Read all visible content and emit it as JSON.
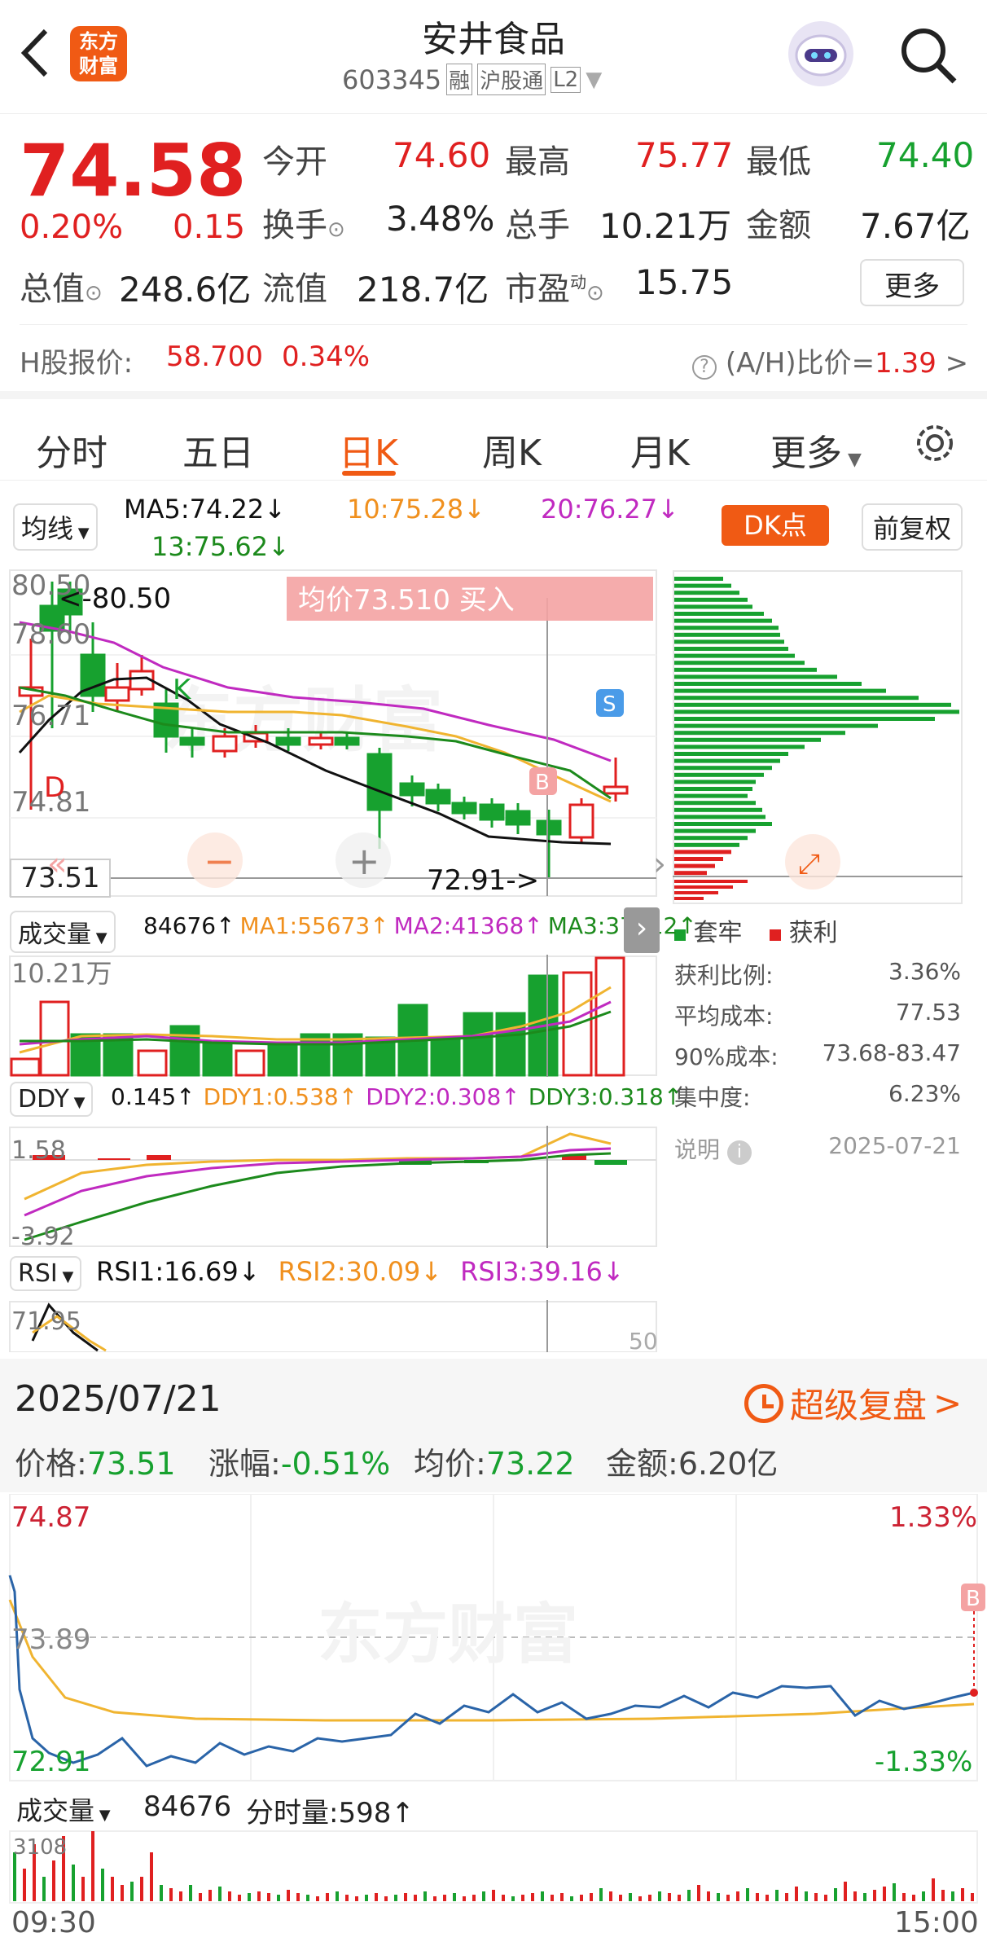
{
  "header": {
    "title": "安井食品",
    "code": "603345",
    "badges": [
      "融",
      "沪股通",
      "L2"
    ],
    "logo_text": "东方\n财富"
  },
  "quote": {
    "price": "74.58",
    "change_pct": "0.20%",
    "change": "0.15",
    "open_label": "今开",
    "open": "74.60",
    "high_label": "最高",
    "high": "75.77",
    "low_label": "最低",
    "low": "74.40",
    "turnover_label": "换手",
    "turnover": "3.48%",
    "volume_label": "总手",
    "volume": "10.21万",
    "amount_label": "金额",
    "amount": "7.67亿",
    "mktcap_label": "总值",
    "mktcap": "248.6亿",
    "float_label": "流值",
    "float": "218.7亿",
    "pe_label": "市盈",
    "pe_sup": "动",
    "pe": "15.75",
    "more_button": "更多",
    "h_label": "H股报价:",
    "h_price": "58.700",
    "h_pct": "0.34%",
    "ah_label": "(A/H)比价=",
    "ah_value": "1.39"
  },
  "tabs": [
    "分时",
    "五日",
    "日K",
    "周K",
    "月K",
    "更多"
  ],
  "active_tab": "日K",
  "kline": {
    "ma_select": "均线",
    "ma5": "MA5:74.22↓",
    "ma10": "10:75.28↓",
    "ma20": "20:76.27↓",
    "ma13": "13:75.62↓",
    "dk_button": "DK点",
    "adjust_button": "前复权",
    "axis_top": "80.50",
    "axis_2": "78.60",
    "axis_3": "76.71",
    "axis_4": "74.81",
    "axis_cursor": "73.51",
    "high_label": "<-80.50",
    "low_label": "72.91->",
    "banner": "均价73.510  买入",
    "marker_d": "D",
    "marker_k": "K",
    "marker_b": "B",
    "marker_s": "S"
  },
  "volume_panel": {
    "select": "成交量",
    "vol": "84676↑",
    "ma1": "MA1:55673↑",
    "ma2": "MA2:41368↑",
    "ma3": "MA3:37112↑",
    "axis_top": "10.21万"
  },
  "ddy_panel": {
    "select": "DDY",
    "v": "0.145↑",
    "ddy1": "DDY1:0.538↑",
    "ddy2": "DDY2:0.308↑",
    "ddy3": "DDY3:0.318↑",
    "axis_top": "1.58",
    "axis_bottom": "-3.92"
  },
  "rsi_panel": {
    "select": "RSI",
    "rsi1": "RSI1:16.69↓",
    "rsi2": "RSI2:30.09↓",
    "rsi3": "RSI3:39.16↓",
    "axis_top": "71.95",
    "axis_right": "50"
  },
  "chips": {
    "legend_trapped": "套牢",
    "legend_profit": "获利",
    "rows": [
      {
        "label": "获利比例:",
        "value": "3.36%"
      },
      {
        "label": "平均成本:",
        "value": "77.53"
      },
      {
        "label": "90%成本:",
        "value": "73.68-83.47"
      },
      {
        "label": "集中度:",
        "value": "6.23%"
      }
    ],
    "note_label": "说明",
    "date": "2025-07-21"
  },
  "intraday": {
    "date": "2025/07/21",
    "replay": "超级复盘",
    "price_label": "价格:",
    "price": "73.51",
    "chg_label": "涨幅:",
    "chg": "-0.51%",
    "avg_label": "均价:",
    "avg": "73.22",
    "amt_label": "金额:",
    "amt": "6.20亿",
    "axis_top": "74.87",
    "axis_mid": "73.89",
    "axis_bottom": "72.91",
    "pct_top": "1.33%",
    "pct_bottom": "-1.33%",
    "vol_select": "成交量",
    "vol": "84676",
    "tick_label": "分时量:598↑",
    "vol_axis": "3108",
    "time_start": "09:30",
    "time_end": "15:00",
    "marker_b": "B"
  },
  "colors": {
    "up": "#e02020",
    "down": "#17a12f",
    "accent": "#f05a14"
  }
}
